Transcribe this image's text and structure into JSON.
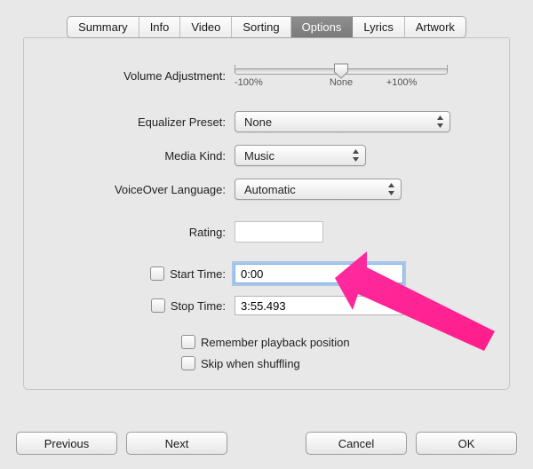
{
  "tabs": {
    "items": [
      "Summary",
      "Info",
      "Video",
      "Sorting",
      "Options",
      "Lyrics",
      "Artwork"
    ],
    "selected_index": 4
  },
  "volume": {
    "label": "Volume Adjustment:",
    "min_label": "-100%",
    "mid_label": "None",
    "max_label": "+100%",
    "value_percent": 0
  },
  "equalizer": {
    "label": "Equalizer Preset:",
    "value": "None"
  },
  "media_kind": {
    "label": "Media Kind:",
    "value": "Music"
  },
  "voiceover": {
    "label": "VoiceOver Language:",
    "value": "Automatic"
  },
  "rating": {
    "label": "Rating:"
  },
  "start_time": {
    "label": "Start Time:",
    "checked": false,
    "value": "0:00"
  },
  "stop_time": {
    "label": "Stop Time:",
    "checked": false,
    "value": "3:55.493"
  },
  "remember_position": {
    "label": "Remember playback position",
    "checked": false
  },
  "skip_shuffling": {
    "label": "Skip when shuffling",
    "checked": false
  },
  "buttons": {
    "previous": "Previous",
    "next": "Next",
    "cancel": "Cancel",
    "ok": "OK"
  }
}
